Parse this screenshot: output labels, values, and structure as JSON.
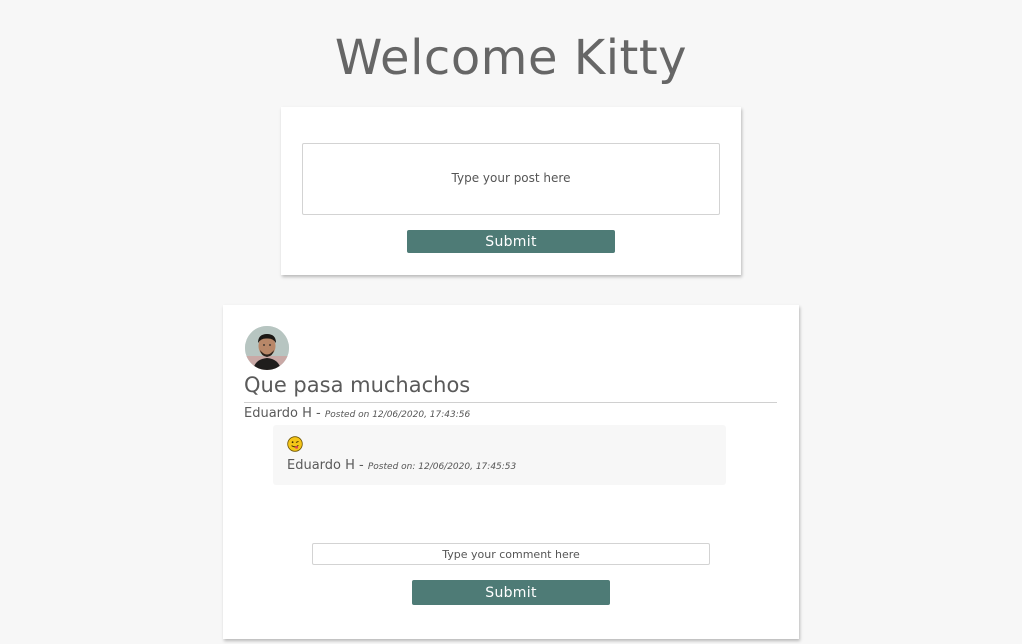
{
  "header": {
    "title": "Welcome Kitty"
  },
  "composer": {
    "placeholder": "Type your post here",
    "submit_label": "Submit"
  },
  "feed": {
    "posts": [
      {
        "text": "Que pasa muchachos",
        "author": "Eduardo H",
        "separator": " - ",
        "posted": "Posted on 12/06/2020, 17:43:56",
        "comments": [
          {
            "emoji": "tongue-out-emoji",
            "author": "Eduardo H",
            "separator": " - ",
            "posted": "Posted on: 12/06/2020, 17:45:53"
          }
        ],
        "comment_placeholder": "Type your comment here",
        "comment_submit_label": "Submit"
      }
    ]
  },
  "colors": {
    "accent": "#4e7b76",
    "background": "#f7f7f7"
  }
}
